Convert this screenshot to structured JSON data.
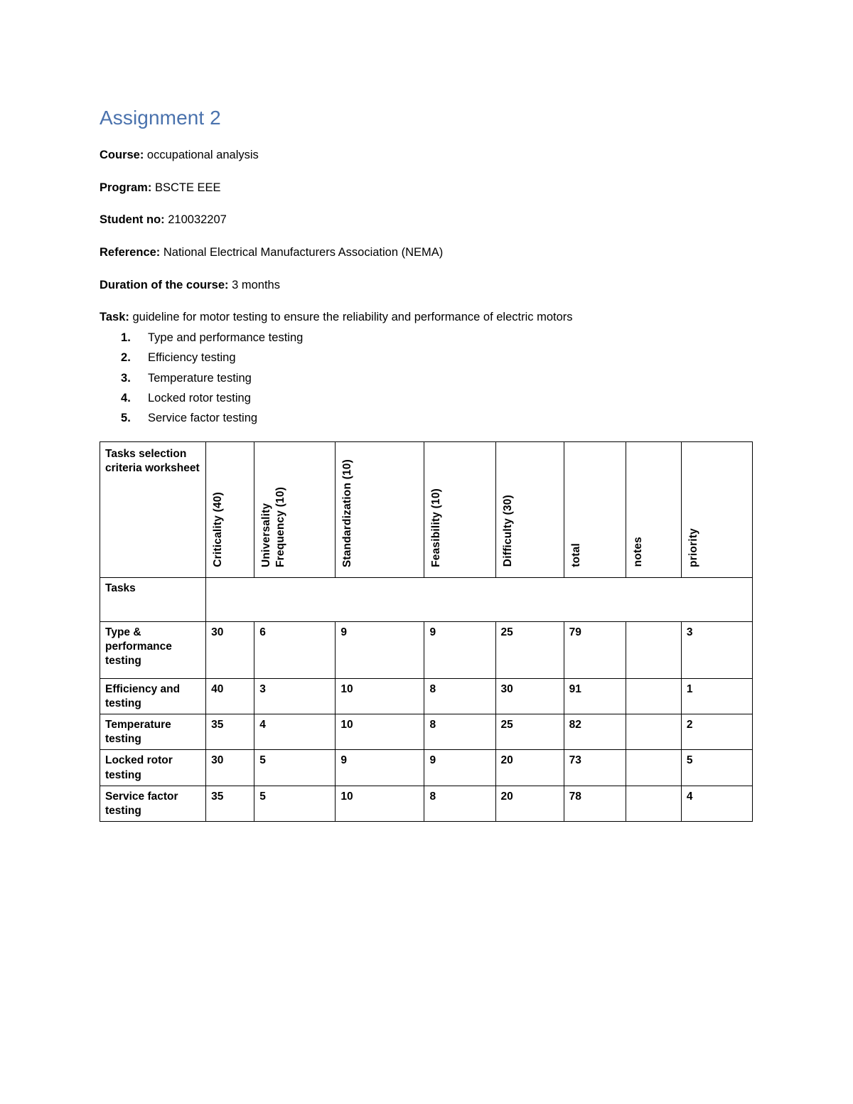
{
  "document": {
    "title": "Assignment 2",
    "meta": [
      {
        "label": "Course:",
        "value": " occupational analysis"
      },
      {
        "label": "Program:",
        "value": " BSCTE EEE"
      },
      {
        "label": "Student no:",
        "value": " 210032207"
      },
      {
        "label": "Reference:",
        "value": " National Electrical Manufacturers Association (NEMA)"
      },
      {
        "label": "Duration of the course:",
        "value": " 3 months"
      }
    ],
    "task_label": "Task:",
    "task_value": " guideline for motor testing to ensure the reliability and performance of electric motors",
    "task_list": [
      "Type and performance testing",
      "Efficiency testing",
      "Temperature testing",
      "Locked rotor testing",
      "Service factor testing"
    ]
  },
  "table": {
    "corner_header": "Tasks selection criteria worksheet",
    "headers": [
      "Criticality (40)",
      "Universality Frequency (10)",
      "Standardization (10)",
      "Feasibility (10)",
      "Difficulty (30)",
      "total",
      "notes",
      "priority"
    ],
    "tasks_row_label": "Tasks",
    "rows": [
      {
        "task": "Type & performance testing",
        "criticality": "30",
        "universality": "6",
        "standardization": "9",
        "feasibility": "9",
        "difficulty": "25",
        "total": "79",
        "notes": "",
        "priority": "3"
      },
      {
        "task": "Efficiency and testing",
        "criticality": "40",
        "universality": "3",
        "standardization": "10",
        "feasibility": "8",
        "difficulty": "30",
        "total": "91",
        "notes": "",
        "priority": "1"
      },
      {
        "task": "Temperature testing",
        "criticality": "35",
        "universality": "4",
        "standardization": "10",
        "feasibility": "8",
        "difficulty": "25",
        "total": "82",
        "notes": "",
        "priority": "2"
      },
      {
        "task": "Locked rotor testing",
        "criticality": "30",
        "universality": "5",
        "standardization": "9",
        "feasibility": "9",
        "difficulty": "20",
        "total": "73",
        "notes": "",
        "priority": "5"
      },
      {
        "task": "Service factor testing",
        "criticality": "35",
        "universality": "5",
        "standardization": "10",
        "feasibility": "8",
        "difficulty": "20",
        "total": "78",
        "notes": "",
        "priority": "4"
      }
    ]
  },
  "colors": {
    "heading": "#4a72ad",
    "text": "#000000",
    "border": "#000000",
    "background": "#ffffff"
  }
}
